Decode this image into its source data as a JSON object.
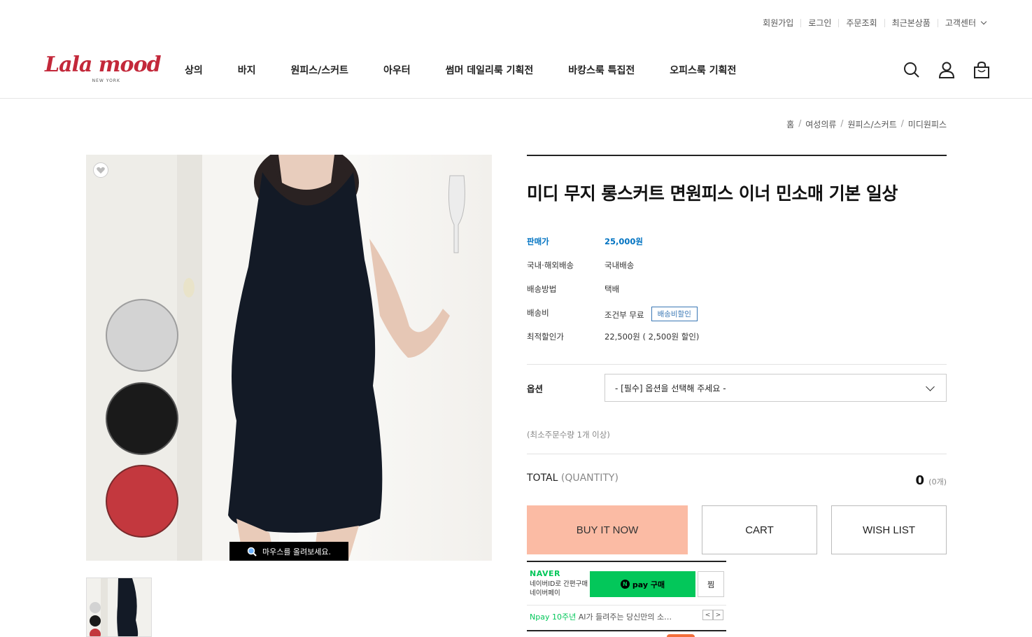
{
  "top_links": [
    "회원가입",
    "로그인",
    "주문조회",
    "최근본상품",
    "고객센터"
  ],
  "brand": {
    "logo_text": "Lala mood",
    "logo_sub": "NEW YORK",
    "color": "#c3283a"
  },
  "nav": [
    "상의",
    "바지",
    "원피스/스커트",
    "아우터",
    "썸머 데일리룩 기획전",
    "바캉스룩 특집전",
    "오피스룩 기획전"
  ],
  "header_icons": [
    "search-icon",
    "user-icon",
    "cart-bag-icon"
  ],
  "breadcrumb": [
    "홈",
    "여성의류",
    "원피스/스커트",
    "미디원피스"
  ],
  "image": {
    "zoom_hint": "마우스를 올려보세요.",
    "color_swatches": [
      "#d3d3d3",
      "#1a1a1a",
      "#c3383e"
    ]
  },
  "product": {
    "title": "미디 무지 롱스커트 면원피스 이너 민소매 기본 일상",
    "specs": [
      {
        "key": "판매가",
        "value": "25,000원"
      },
      {
        "key": "국내·해외배송",
        "value": "국내배송"
      },
      {
        "key": "배송방법",
        "value": "택배"
      },
      {
        "key": "배송비",
        "value": "조건부 무료"
      },
      {
        "key": "최적할인가",
        "value": "22,500원 ( 2,500원 할인)"
      }
    ],
    "shipping_badge": "배송비할인"
  },
  "option": {
    "label": "옵션",
    "selected": "- [필수] 옵션을 선택해 주세요 -"
  },
  "min_order": "(최소주문수량 1개 이상)",
  "total": {
    "label": "TOTAL",
    "sub": "(QUANTITY)",
    "value": "0",
    "count": "(0개)"
  },
  "buttons": {
    "buy": "BUY IT NOW",
    "cart": "CART",
    "wish": "WISH LIST"
  },
  "npay": {
    "brand": "NAVER",
    "desc1": "네이버ID로 간편구매",
    "desc2": "네이버페이",
    "buy_label": "pay 구매",
    "wish_label": "찜",
    "promo_highlight": "Npay 10주년",
    "promo_text": "AI가 들려주는 당신만의 소…"
  },
  "colors": {
    "accent_price": "#0073c2",
    "buy_button": "#fbbba4",
    "npay_green": "#03c75a"
  }
}
